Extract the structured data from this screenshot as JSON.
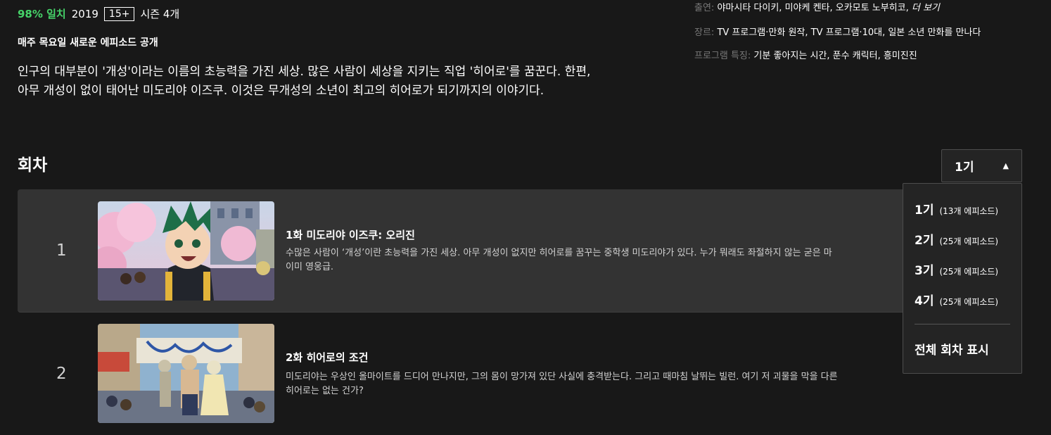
{
  "meta": {
    "match": "98% 일치",
    "year": "2019",
    "rating": "15+",
    "seasons": "시즌 4개"
  },
  "new_episode_notice": "매주 목요일 새로운 에피소드 공개",
  "synopsis_line1": "인구의 대부분이 '개성'이라는 이름의 초능력을 가진 세상. 많은 사람이 세상을 지키는 직업 '히어로'를 꿈꾼다. 한편,",
  "synopsis_line2": "아무 개성이 없이 태어난 미도리야 이즈쿠. 이것은 무개성의 소년이 최고의 히어로가 되기까지의 이야기다.",
  "info": {
    "cast_key": "출연:",
    "cast_val": "야마시타 다이키, 미야케 켄타, 오카모토 노부히코,",
    "cast_more": "더 보기",
    "genre_key": "장르:",
    "genre_val": "TV 프로그램·만화 원작, TV 프로그램·10대, 일본 소년 만화를 만나다",
    "features_key": "프로그램 특징:",
    "features_val": "기분 좋아지는 시간, 푼수 캐릭터, 흥미진진"
  },
  "episodes_title": "회차",
  "season_select": {
    "selected": "1기",
    "caret_icon": "caret-up-icon"
  },
  "episodes": [
    {
      "number": "1",
      "title": "1화 미도리야 이즈쿠: 오리진",
      "desc_line1": "수많은 사람이 ‘개성’이란 초능력을 가진 세상. 아무 개성이 없지만 히어로를 꿈꾸는 중학생 미도리야가 있다. 누가 뭐래도 좌절하지 않는 굳은 마",
      "desc_line2": "이미 영웅급."
    },
    {
      "number": "2",
      "title": "2화 히어로의 조건",
      "desc_line1": "미도리야는 우상인 올마이트를 드디어 만나지만, 그의 몸이 망가져 있단 사실에 충격받는다. 그리고 때마침 날뛰는 빌런. 여기 저 괴물을 막을 다른",
      "desc_line2": "히어로는 없는 건가?"
    }
  ],
  "dropdown": {
    "items": [
      {
        "season": "1기",
        "count": "(13개 에피소드)"
      },
      {
        "season": "2기",
        "count": "(25개 에피소드)"
      },
      {
        "season": "3기",
        "count": "(25개 에피소드)"
      },
      {
        "season": "4기",
        "count": "(25개 에피소드)"
      }
    ],
    "show_all": "전체 회차 표시"
  },
  "colors": {
    "match_green": "#46d369",
    "background": "#181818",
    "active_row": "#333333"
  }
}
